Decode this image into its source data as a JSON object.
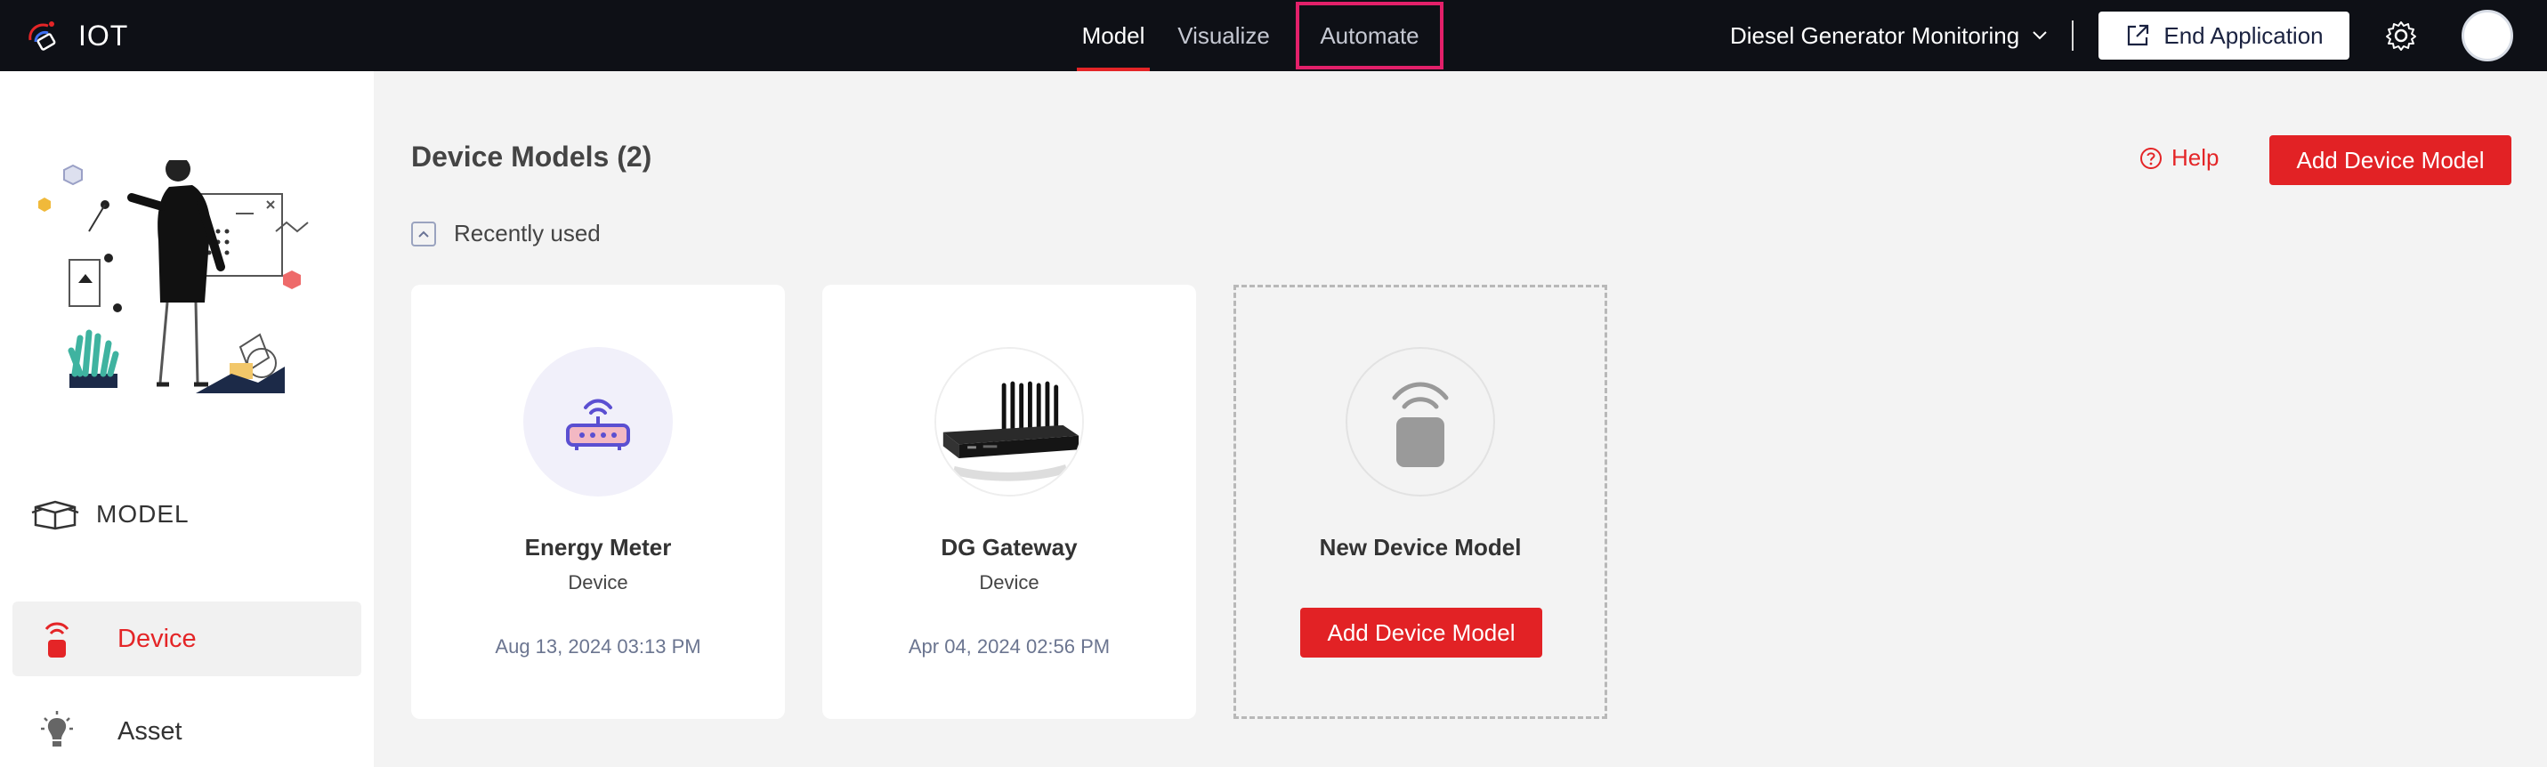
{
  "app": {
    "name": "IOT"
  },
  "nav": {
    "tabs": [
      {
        "label": "Model",
        "active": true
      },
      {
        "label": "Visualize",
        "active": false
      },
      {
        "label": "Automate",
        "active": false
      }
    ]
  },
  "header": {
    "application": "Diesel Generator Monitoring",
    "end_label": "End Application"
  },
  "sidebar": {
    "section": "MODEL",
    "items": [
      {
        "label": "Device",
        "active": true
      },
      {
        "label": "Asset",
        "active": false
      }
    ]
  },
  "main": {
    "title": "Device Models (2)",
    "help_label": "Help",
    "add_label": "Add Device Model",
    "recent_label": "Recently used",
    "cards": [
      {
        "name": "Energy Meter",
        "type": "Device",
        "date": "Aug 13, 2024 03:13 PM"
      },
      {
        "name": "DG Gateway",
        "type": "Device",
        "date": "Apr 04, 2024 02:56 PM"
      }
    ],
    "new_card": {
      "name": "New Device Model",
      "button": "Add Device Model"
    }
  },
  "colors": {
    "accent": "#e22225",
    "topbar": "#0e1016",
    "highlight": "#e3206a"
  }
}
